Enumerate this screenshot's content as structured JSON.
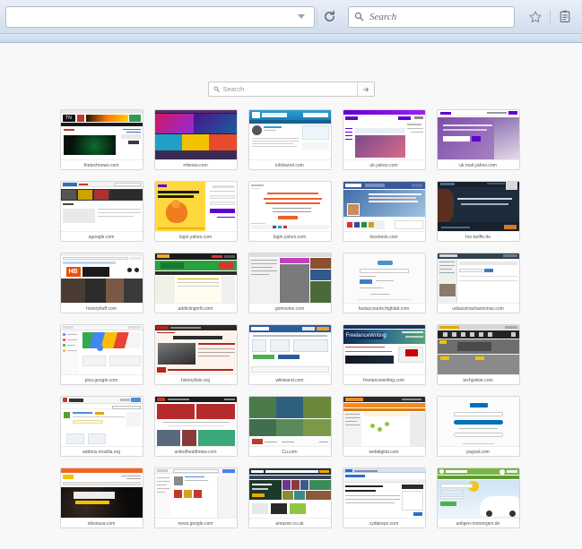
{
  "browser": {
    "urlbar": {
      "value": "",
      "dropmarker": "dropmarker-icon"
    },
    "reload": {
      "name": "reload-button",
      "tooltip": "Reload"
    },
    "search": {
      "placeholder": "Search",
      "icon": "search-icon"
    },
    "bookmark_star": {
      "name": "bookmark-star-icon"
    },
    "sidebar": {
      "name": "reader-list-icon"
    }
  },
  "newtab": {
    "search": {
      "placeholder": "Search",
      "icon": "search-icon",
      "go_label": "→"
    },
    "tiles": [
      {
        "label": "thetechnews.com",
        "accent": "#111111",
        "kind": "tech-news"
      },
      {
        "label": "mfsnea.com",
        "accent": "#7b2d8e",
        "kind": "colorful-mag"
      },
      {
        "label": "infobarrel.com",
        "accent": "#2b8fc4",
        "kind": "infobarrel"
      },
      {
        "label": "uk.yahoo.com",
        "accent": "#6001d2",
        "kind": "yahoo-home"
      },
      {
        "label": "uk.mail.yahoo.com",
        "accent": "#6001d2",
        "kind": "yahoo-mail"
      },
      {
        "label": "agoogle.com",
        "accent": "#2f6fb5",
        "kind": "news-portal"
      },
      {
        "label": "login.yahoo.com",
        "accent": "#ffcc33",
        "kind": "yahoo-pwd"
      },
      {
        "label": "login.yahoo.com",
        "accent": "#e8622c",
        "kind": "yahoo-signin"
      },
      {
        "label": "facebook.com",
        "accent": "#3b5998",
        "kind": "facebook"
      },
      {
        "label": "hrs-tariffe.de",
        "accent": "#1b2a3a",
        "kind": "dark-hotel"
      },
      {
        "label": "historybuff.com",
        "accent": "#e8520f",
        "kind": "historybuff"
      },
      {
        "label": "addictinginfo.com",
        "accent": "#1f9c3b",
        "kind": "green-sports"
      },
      {
        "label": "gomovies.com",
        "accent": "#b43fb4",
        "kind": "movies-grid"
      },
      {
        "label": "fastaccounts.highlab.com",
        "accent": "#4e8fd0",
        "kind": "collabchat-login"
      },
      {
        "label": "usbazzinacharizonas.com",
        "accent": "#33424f",
        "kind": "admin-console"
      },
      {
        "label": "plus.google.com",
        "accent": "#4285f4",
        "kind": "gplus"
      },
      {
        "label": "historylists.org",
        "accent": "#b3261e",
        "kind": "historylists"
      },
      {
        "label": "wikiwand.com",
        "accent": "#2a5d9e",
        "kind": "wikibuy"
      },
      {
        "label": "freelancewriting.com",
        "accent": "#13315c",
        "kind": "freelancewriting"
      },
      {
        "label": "techjunkie.com",
        "accent": "#202020",
        "kind": "techjunkie"
      },
      {
        "label": "addons.mozilla.org",
        "accent": "#5a9e2f",
        "kind": "amo"
      },
      {
        "label": "unitedhealthnew.com",
        "accent": "#b32b2b",
        "kind": "red-article"
      },
      {
        "label": "Cu.com",
        "accent": "#3f7f4f",
        "kind": "green-tiles"
      },
      {
        "label": "webdigital.com",
        "accent": "#f58b1f",
        "kind": "orange-stats"
      },
      {
        "label": "paypal.com",
        "accent": "#0070ba",
        "kind": "paypal"
      },
      {
        "label": "nikonusa.com",
        "accent": "#f26522",
        "kind": "nikon"
      },
      {
        "label": "news.google.com",
        "accent": "#4285f4",
        "kind": "gnews"
      },
      {
        "label": "amazon.co.uk",
        "accent": "#232f3e",
        "kind": "amazon"
      },
      {
        "label": "cydiarepo.com",
        "accent": "#2a6fc9",
        "kind": "cydia"
      },
      {
        "label": "anligen-motoregen.de",
        "accent": "#7ab648",
        "kind": "car-insurance"
      }
    ]
  }
}
